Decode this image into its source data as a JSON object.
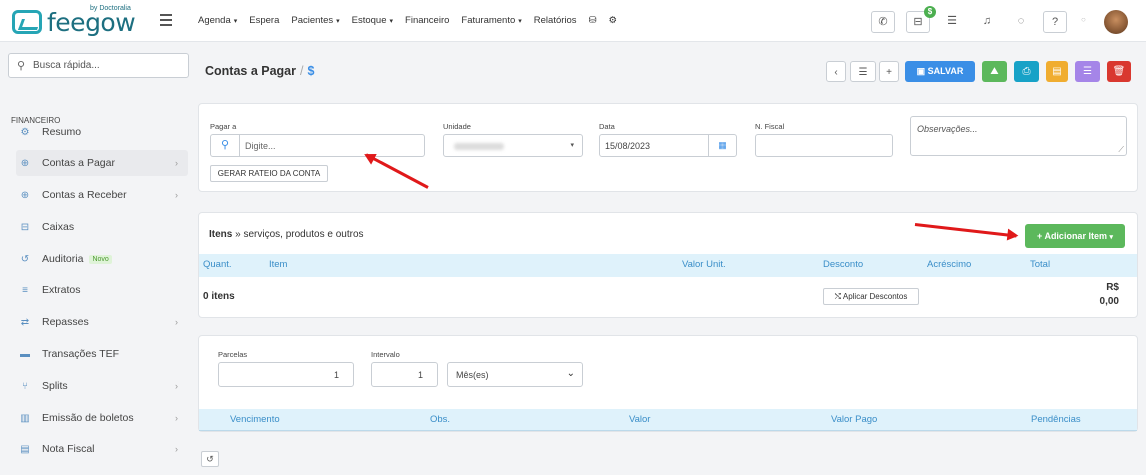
{
  "brand": {
    "name": "feegow",
    "by": "by Doctoralia"
  },
  "nav": {
    "items": [
      {
        "label": "Agenda",
        "dropdown": true
      },
      {
        "label": "Espera",
        "dropdown": false
      },
      {
        "label": "Pacientes",
        "dropdown": true
      },
      {
        "label": "Estoque",
        "dropdown": true
      },
      {
        "label": "Financeiro",
        "dropdown": false
      },
      {
        "label": "Faturamento",
        "dropdown": true
      },
      {
        "label": "Relatórios",
        "dropdown": false
      }
    ],
    "caret": "▾",
    "badge": "$"
  },
  "sidebar": {
    "search_placeholder": "Busca rápida...",
    "section_title": "FINANCEIRO",
    "items": [
      {
        "label": "Resumo",
        "icon": "cog-icon",
        "glyph": "⚙",
        "chevron": false
      },
      {
        "label": "Contas a Pagar",
        "icon": "plus-circle-icon",
        "glyph": "⊕",
        "chevron": true
      },
      {
        "label": "Contas a Receber",
        "icon": "plus-circle-icon",
        "glyph": "⊕",
        "chevron": true
      },
      {
        "label": "Caixas",
        "icon": "inbox-icon",
        "glyph": "⊟",
        "chevron": false
      },
      {
        "label": "Auditoria",
        "icon": "history-icon",
        "glyph": "↺",
        "chevron": false,
        "tag": "Novo"
      },
      {
        "label": "Extratos",
        "icon": "list-icon",
        "glyph": "≡",
        "chevron": false
      },
      {
        "label": "Repasses",
        "icon": "transfer-icon",
        "glyph": "⇄",
        "chevron": true
      },
      {
        "label": "Transações TEF",
        "icon": "card-icon",
        "glyph": "▬",
        "chevron": false
      },
      {
        "label": "Splits",
        "icon": "split-icon",
        "glyph": "⑂",
        "chevron": true
      },
      {
        "label": "Emissão de boletos",
        "icon": "barcode-icon",
        "glyph": "▥",
        "chevron": true
      },
      {
        "label": "Nota Fiscal",
        "icon": "document-icon",
        "glyph": "▤",
        "chevron": true
      }
    ],
    "chevron": "›",
    "active_index": 1
  },
  "page": {
    "title": "Contas a Pagar",
    "separator": "/",
    "currency": "$",
    "save_label": "SALVAR"
  },
  "form": {
    "pagar_a_label": "Pagar a",
    "pagar_a_placeholder": "Digite...",
    "rateio_label": "GERAR RATEIO DA CONTA",
    "unidade_label": "Unidade",
    "unidade_value": "",
    "data_label": "Data",
    "data_value": "15/08/2023",
    "nfiscal_label": "N. Fiscal",
    "nfiscal_value": "",
    "observacoes_placeholder": "Observações..."
  },
  "items": {
    "title": "Itens",
    "subtitle": " » serviços, produtos e outros",
    "add_label": "+ Adicionar Item",
    "columns": [
      "Quant.",
      "Item",
      "Valor Unit.",
      "Desconto",
      "Acréscimo",
      "Total"
    ],
    "count_text": "0 itens",
    "discount_btn": "⤭ Aplicar Descontos",
    "total_currency": "R$",
    "total_value": "0,00"
  },
  "parcelas": {
    "parcelas_label": "Parcelas",
    "parcelas_value": "1",
    "intervalo_label": "Intervalo",
    "intervalo_value": "1",
    "periodo_value": "Mês(es)",
    "columns": [
      "Vencimento",
      "Obs.",
      "Valor",
      "Valor Pago",
      "Pendências"
    ]
  },
  "colors": {
    "primary": "#3a8ee6",
    "success": "#5cb85c",
    "info": "#17a2c7",
    "warning": "#f0ad30",
    "purple": "#a585e8",
    "danger": "#d9382f",
    "header": "#dff2fb"
  }
}
